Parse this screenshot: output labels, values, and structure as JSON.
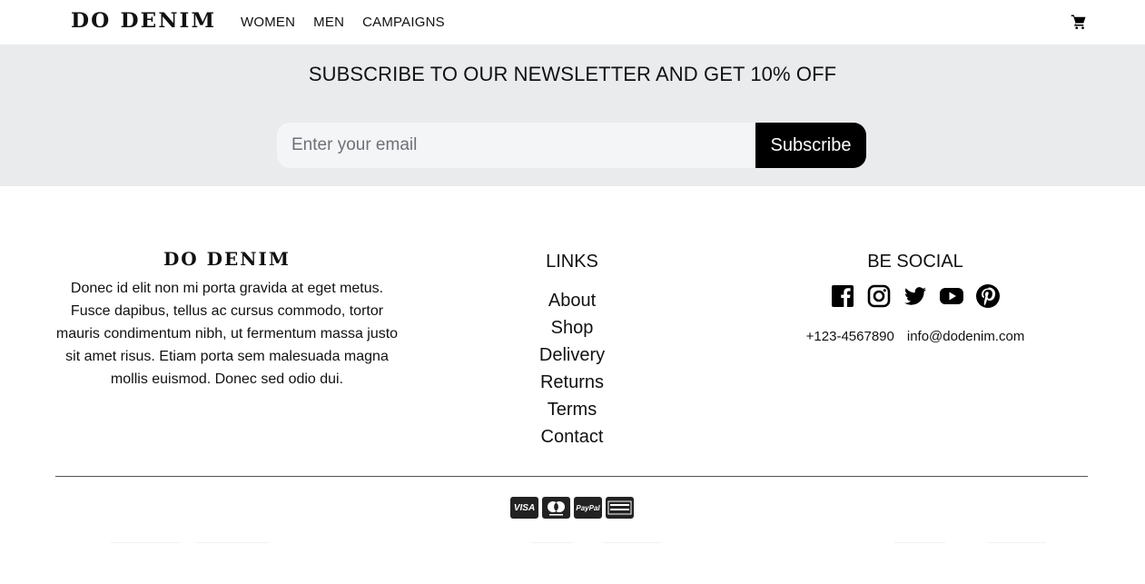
{
  "header": {
    "logo": "DO DENIM",
    "nav": [
      {
        "label": "WOMEN"
      },
      {
        "label": "MEN"
      },
      {
        "label": "CAMPAIGNS"
      }
    ],
    "cart_icon": "cart-icon"
  },
  "newsletter": {
    "title": "SUBSCRIBE TO OUR NEWSLETTER AND GET 10% OFF",
    "email_placeholder": "Enter your email",
    "subscribe_label": "Subscribe"
  },
  "footer": {
    "about": {
      "logo": "DO DENIM",
      "text": "Donec id elit non mi porta gravida at eget metus. Fusce dapibus, tellus ac cursus commodo, tortor mauris condimentum nibh, ut fermentum massa justo sit amet risus. Etiam porta sem malesuada magna mollis euismod. Donec sed odio dui."
    },
    "links": {
      "title": "LINKS",
      "items": [
        "About",
        "Shop",
        "Delivery",
        "Returns",
        "Terms",
        "Contact"
      ]
    },
    "social": {
      "title": "BE SOCIAL",
      "icons": [
        "facebook-icon",
        "instagram-icon",
        "twitter-icon",
        "youtube-icon",
        "pinterest-icon"
      ],
      "phone": "+123-4567890",
      "email": "info@dodenim.com"
    },
    "payments": {
      "icons": [
        "visa-icon",
        "mastercard-icon",
        "paypal-icon",
        "american-express-icon"
      ],
      "visa_text": "VISA",
      "paypal_text": "PayPal"
    }
  }
}
